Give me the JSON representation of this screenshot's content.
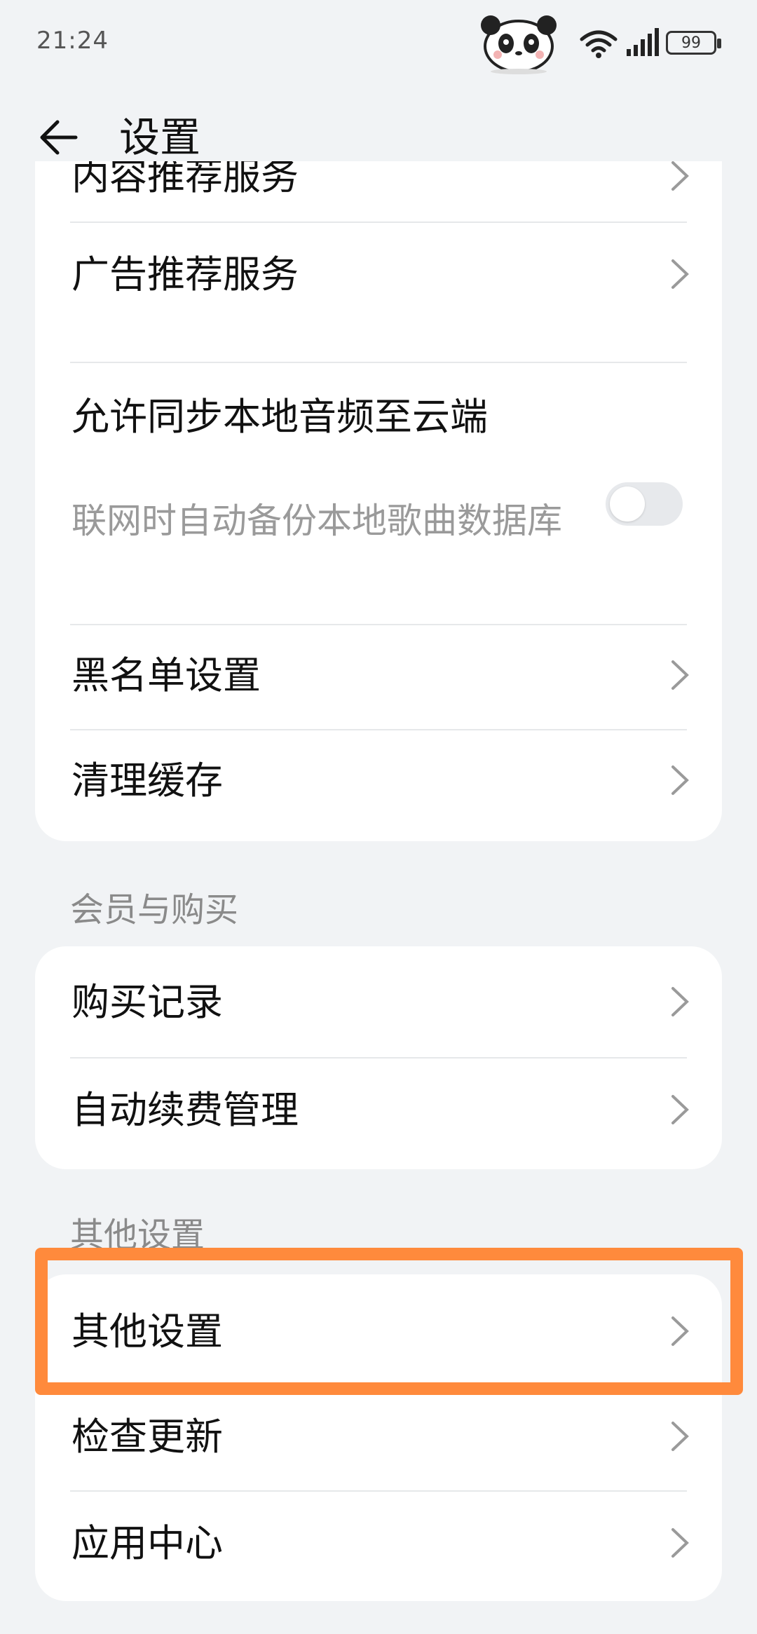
{
  "status": {
    "time": "21:24",
    "battery": "99"
  },
  "header": {
    "title": "设置"
  },
  "card1": {
    "rows": [
      {
        "label": "内容推荐服务"
      },
      {
        "label": "广告推荐服务"
      },
      {
        "label": "允许同步本地音频至云端",
        "subtitle": "联网时自动备份本地歌曲数据库",
        "toggle": false
      },
      {
        "label": "黑名单设置"
      },
      {
        "label": "清理缓存"
      }
    ]
  },
  "section_member": {
    "title": "会员与购买"
  },
  "card2": {
    "rows": [
      {
        "label": "购买记录"
      },
      {
        "label": "自动续费管理"
      }
    ]
  },
  "section_other": {
    "title": "其他设置"
  },
  "card3": {
    "rows": [
      {
        "label": "其他设置"
      },
      {
        "label": "检查更新"
      },
      {
        "label": "应用中心"
      }
    ]
  },
  "colors": {
    "highlight": "#ff8a3c",
    "background": "#f1f3f5"
  },
  "icons": [
    "back-arrow-icon",
    "chevron-right-icon",
    "wifi-icon",
    "signal-icon",
    "battery-icon",
    "panda-icon"
  ]
}
